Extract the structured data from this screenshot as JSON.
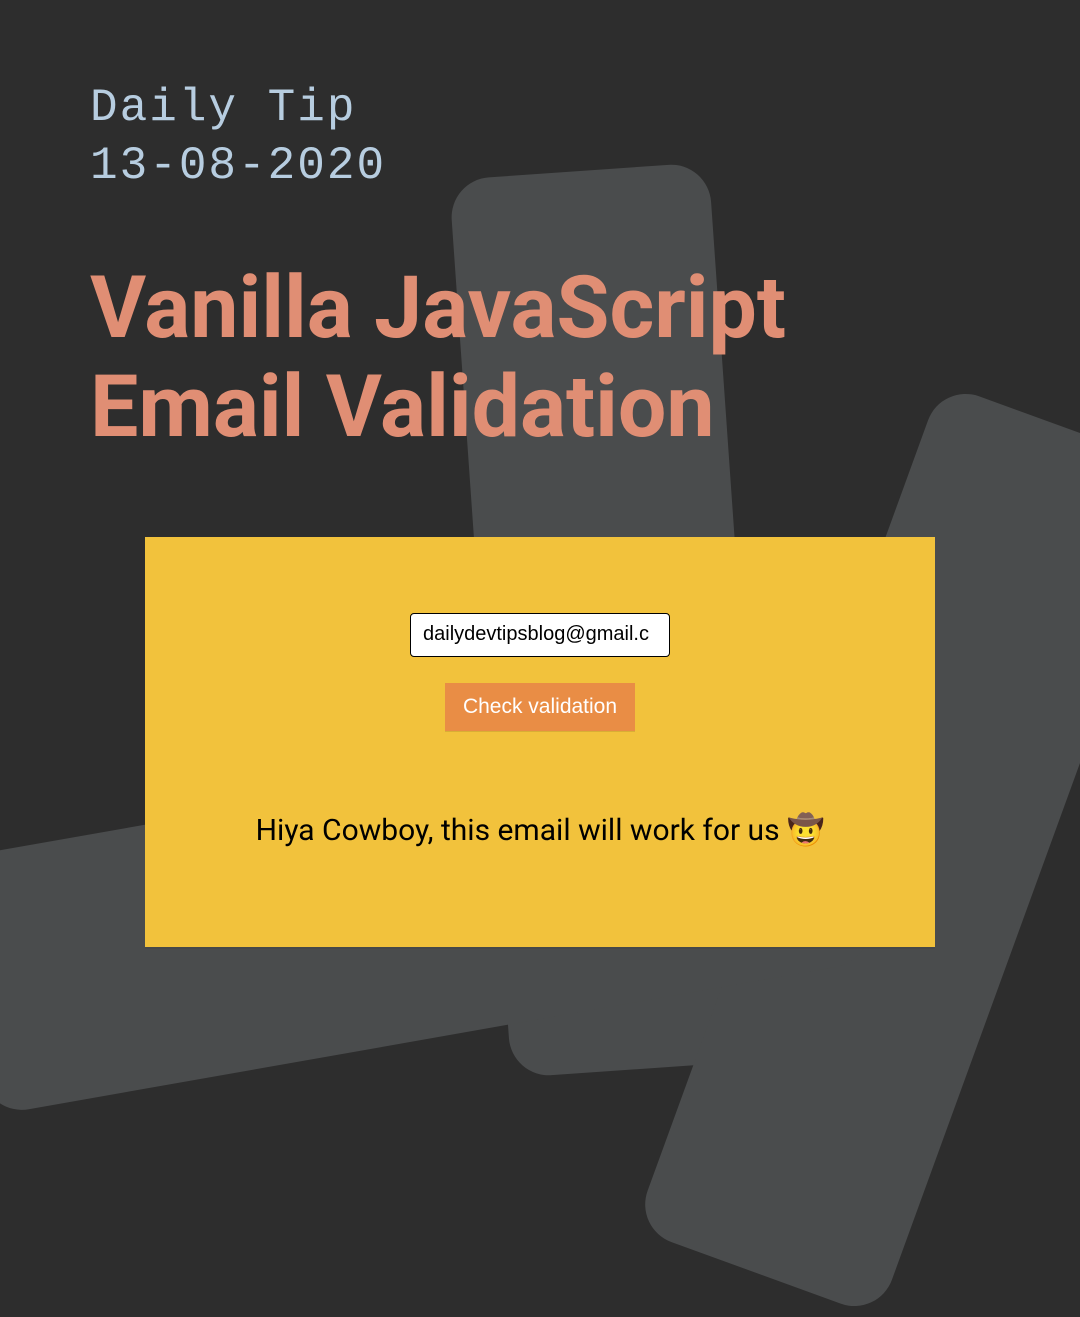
{
  "header": {
    "eyebrow_line1": "Daily Tip",
    "eyebrow_line2": "13-08-2020",
    "title_line1": "Vanilla JavaScript",
    "title_line2": "Email Validation"
  },
  "demo": {
    "email_value": "dailydevtipsblog@gmail.c",
    "check_button_label": "Check validation",
    "result_text": "Hiya Cowboy, this email will work for us 🤠"
  }
}
